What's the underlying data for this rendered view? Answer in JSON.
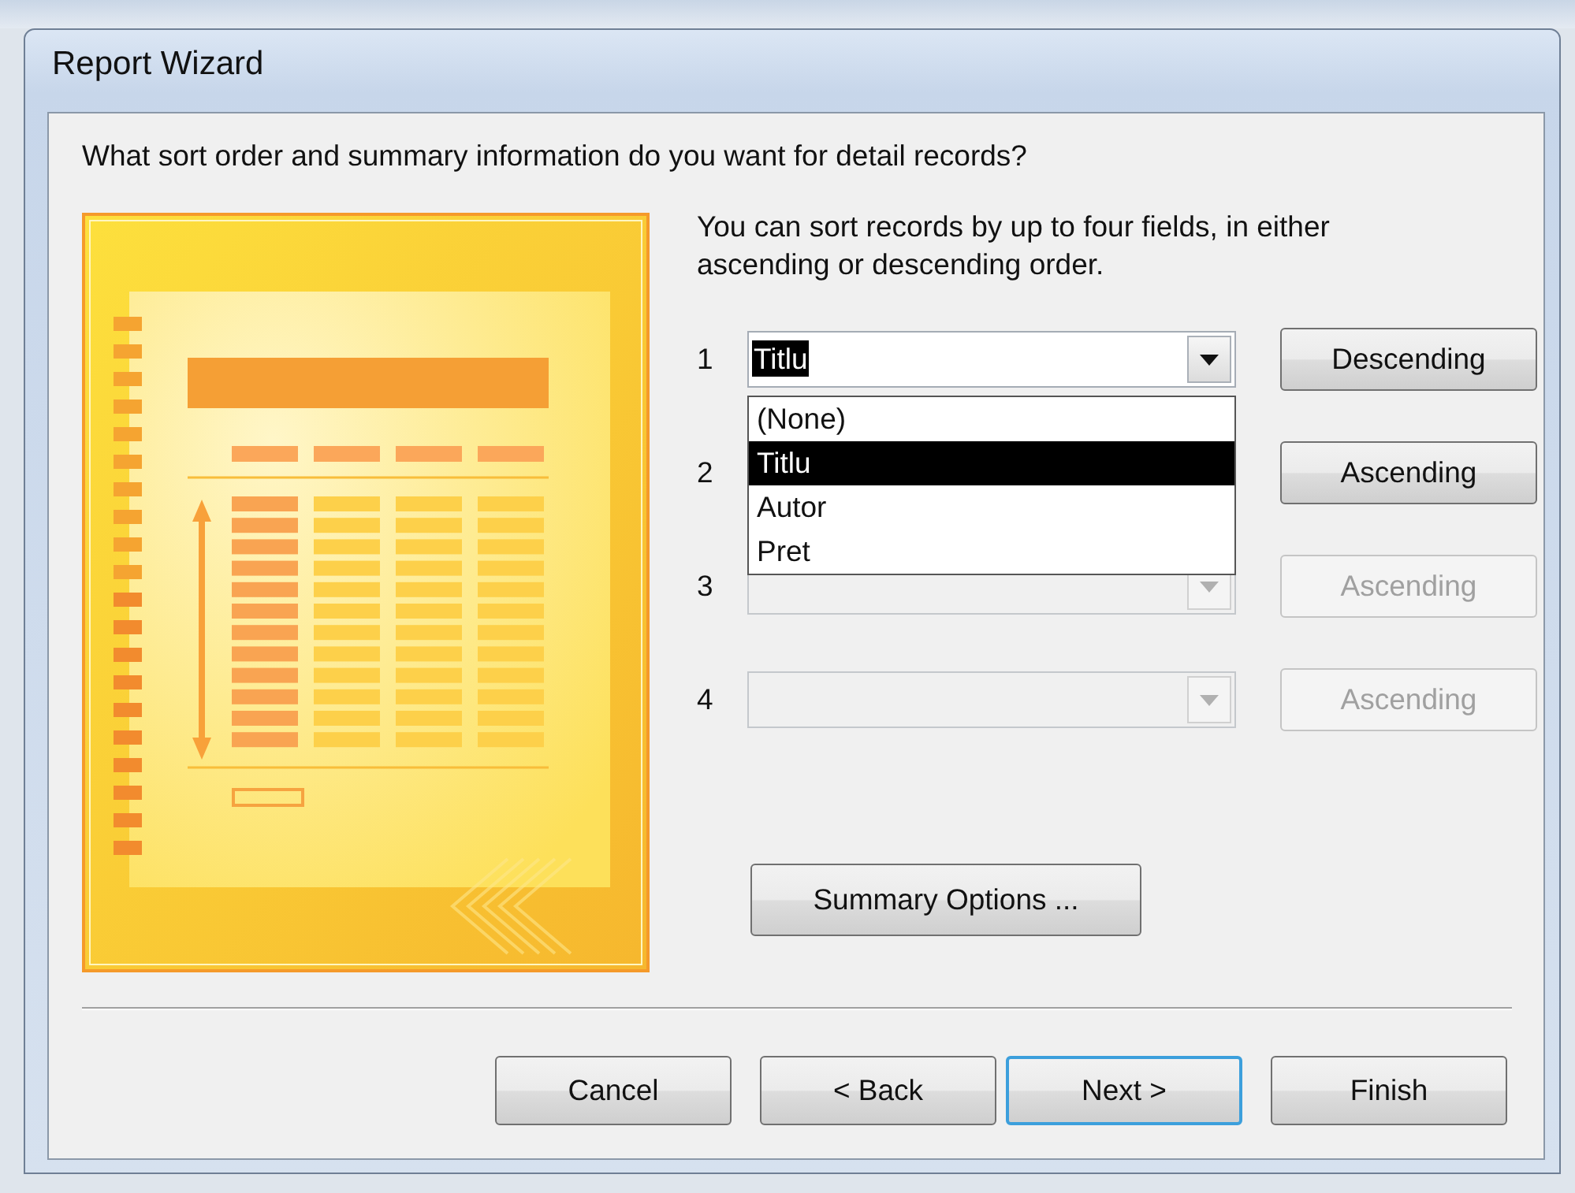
{
  "window": {
    "title": "Report Wizard"
  },
  "question": "What sort order and summary information do you want for detail records?",
  "description": "You can sort records by up to four fields, in either ascending or descending order.",
  "sort_rows": [
    {
      "number": "1",
      "value": "Titlu",
      "value_highlighted": true,
      "disabled": false,
      "order": "Descending"
    },
    {
      "number": "2",
      "field_covered": true,
      "disabled": false,
      "order": "Ascending"
    },
    {
      "number": "3",
      "disabled": true,
      "order": "Ascending"
    },
    {
      "number": "4",
      "disabled": true,
      "order": "Ascending"
    }
  ],
  "dropdown": {
    "items": [
      {
        "label": "(None)",
        "selected": false
      },
      {
        "label": "Titlu",
        "selected": true
      },
      {
        "label": "Autor",
        "selected": false
      },
      {
        "label": "Pret",
        "selected": false
      }
    ]
  },
  "summary_button": "Summary Options ...",
  "buttons": [
    {
      "label": "Cancel",
      "default": false
    },
    {
      "label": "< Back",
      "default": false
    },
    {
      "label": "Next >",
      "default": true
    },
    {
      "label": "Finish",
      "default": false
    }
  ]
}
